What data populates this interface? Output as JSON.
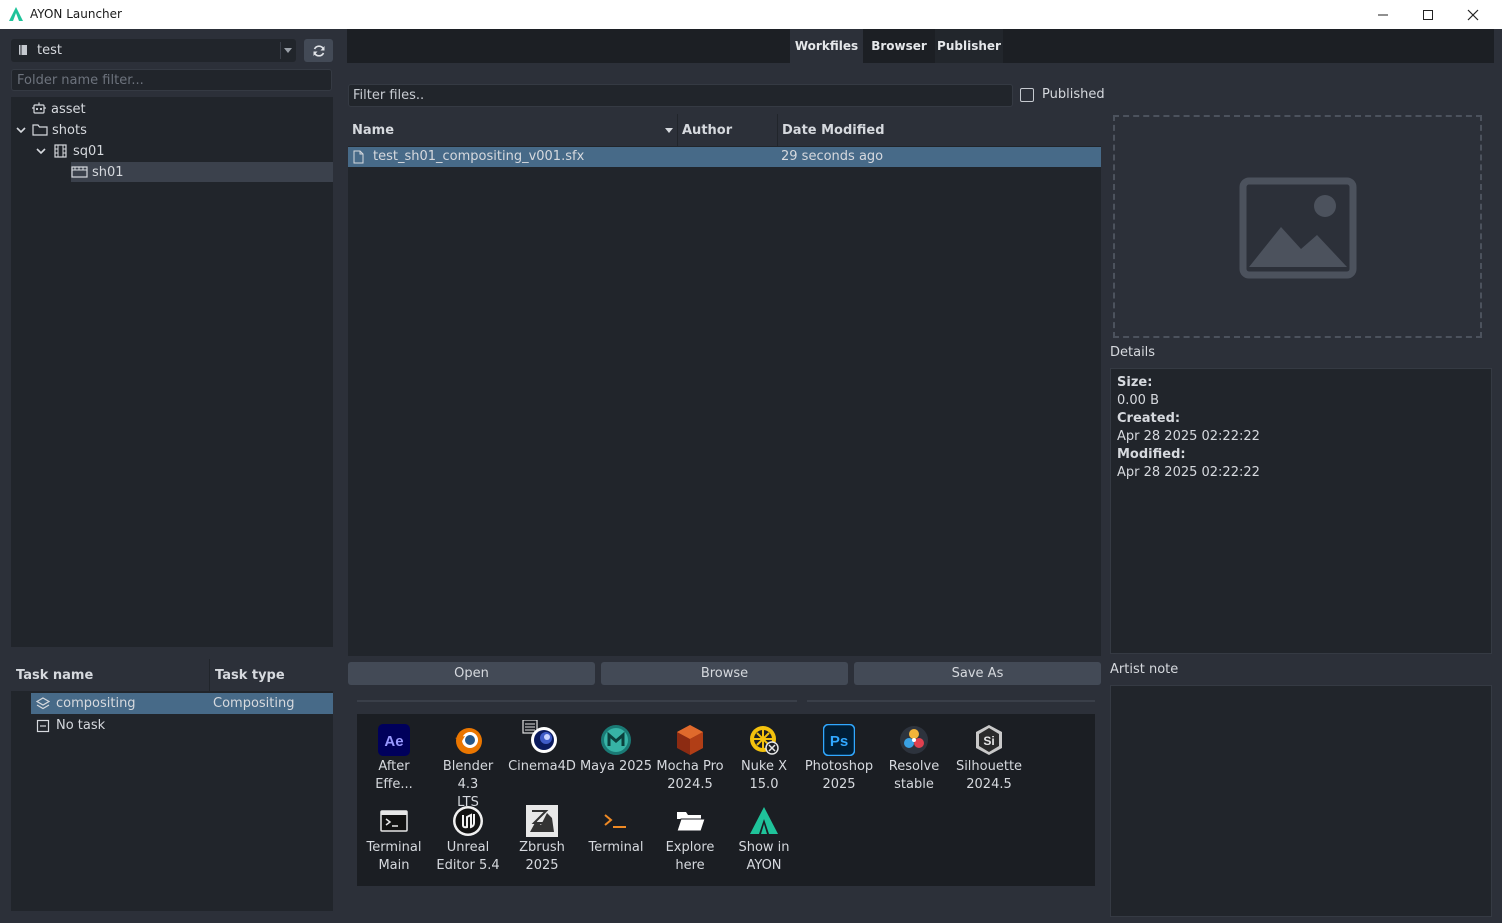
{
  "window": {
    "title": "AYON Launcher"
  },
  "project": {
    "name": "test"
  },
  "folder_filter": {
    "placeholder": "Folder name filter..."
  },
  "folders": [
    {
      "label": "asset",
      "icon": "asset-icon"
    },
    {
      "label": "shots",
      "icon": "folder-icon"
    },
    {
      "label": "sq01",
      "icon": "sequence-icon"
    },
    {
      "label": "sh01",
      "icon": "shot-icon"
    }
  ],
  "tasks": {
    "headers": [
      "Task name",
      "Task type"
    ],
    "rows": [
      {
        "name": "compositing",
        "type": "Compositing"
      },
      {
        "name": "No task",
        "type": ""
      }
    ]
  },
  "tabs": [
    "Workfiles",
    "Browser",
    "Publisher"
  ],
  "files": {
    "filter_placeholder": "Filter files..",
    "published_label": "Published",
    "headers": [
      "Name",
      "Author",
      "Date Modified"
    ],
    "rows": [
      {
        "name": "test_sh01_compositing_v001.sfx",
        "author": "",
        "modified": "29 seconds ago"
      }
    ]
  },
  "buttons": {
    "open": "Open",
    "browse": "Browse",
    "save_as": "Save As"
  },
  "details": {
    "title": "Details",
    "size_label": "Size:",
    "size": "0.00 B",
    "created_label": "Created:",
    "created": "Apr 28 2025 02:22:22",
    "modified_label": "Modified:",
    "modified": "Apr 28 2025 02:22:22"
  },
  "artist_note": {
    "title": "Artist note"
  },
  "apps": [
    {
      "line1": "After",
      "line2": "Effe...",
      "icon": "after-effects-icon"
    },
    {
      "line1": "Blender 4.3",
      "line2": "LTS",
      "icon": "blender-icon"
    },
    {
      "line1": "Cinema4D",
      "line2": "",
      "icon": "cinema4d-icon"
    },
    {
      "line1": "Maya 2025",
      "line2": "",
      "icon": "maya-icon"
    },
    {
      "line1": "Mocha Pro",
      "line2": "2024.5",
      "icon": "mocha-pro-icon"
    },
    {
      "line1": "Nuke X",
      "line2": "15.0",
      "icon": "nuke-icon"
    },
    {
      "line1": "Photoshop",
      "line2": "2025",
      "icon": "photoshop-icon"
    },
    {
      "line1": "Resolve",
      "line2": "stable",
      "icon": "resolve-icon"
    },
    {
      "line1": "Silhouette",
      "line2": "2024.5",
      "icon": "silhouette-icon"
    },
    {
      "line1": "Terminal",
      "line2": "Main",
      "icon": "terminal-main-icon"
    },
    {
      "line1": "Unreal",
      "line2": "Editor 5.4",
      "icon": "unreal-icon"
    },
    {
      "line1": "Zbrush",
      "line2": "2025",
      "icon": "zbrush-icon"
    },
    {
      "line1": "Terminal",
      "line2": "",
      "icon": "terminal-icon"
    },
    {
      "line1": "Explore",
      "line2": "here",
      "icon": "explore-folder-icon"
    },
    {
      "line1": "Show in",
      "line2": "AYON",
      "icon": "ayon-icon"
    }
  ],
  "colors": {
    "accent_selection": "#476a88",
    "ayon_green": "#1fc39a",
    "background": "#2c3039"
  }
}
